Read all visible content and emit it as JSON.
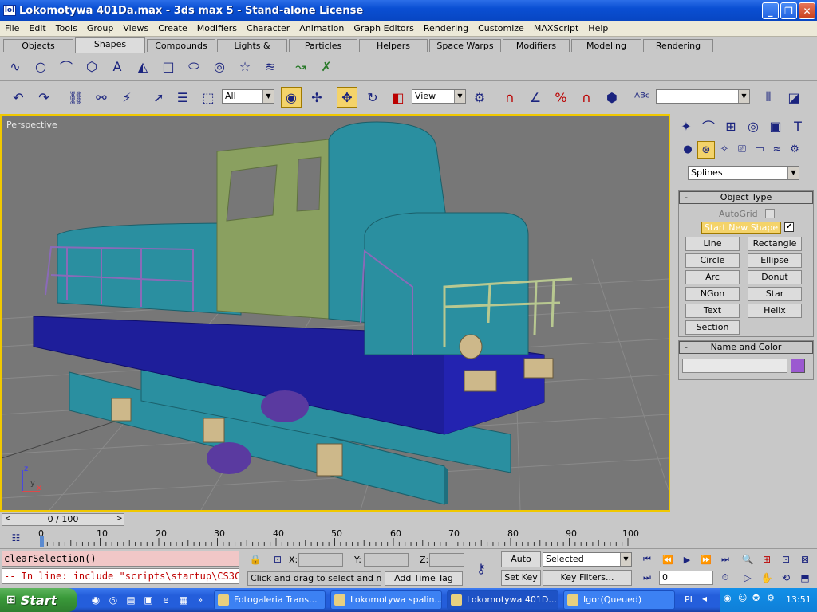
{
  "window": {
    "title": "Lokomotywa 401Da.max - 3ds max 5 - Stand-alone License",
    "icon_text": "lol"
  },
  "menu": [
    "File",
    "Edit",
    "Tools",
    "Group",
    "Views",
    "Create",
    "Modifiers",
    "Character",
    "Animation",
    "Graph Editors",
    "Rendering",
    "Customize",
    "MAXScript",
    "Help"
  ],
  "tabs": [
    "Objects",
    "Shapes",
    "Compounds",
    "Lights & Cameras",
    "Particles",
    "Helpers",
    "Space Warps",
    "Modifiers",
    "Modeling",
    "Rendering"
  ],
  "active_tab": "Shapes",
  "toolbar": {
    "selection_filter": "All",
    "reference_coord": "View",
    "named_selection": ""
  },
  "viewport": {
    "label": "Perspective",
    "axis_x": "x",
    "axis_y": "y",
    "axis_z": "z"
  },
  "command_panel": {
    "category": "Splines",
    "object_type": {
      "title": "Object Type",
      "autogrid": "AutoGrid",
      "start_new_shape": "Start New Shape",
      "buttons": [
        "Line",
        "Rectangle",
        "Circle",
        "Ellipse",
        "Arc",
        "Donut",
        "NGon",
        "Star",
        "Text",
        "Helix",
        "Section"
      ]
    },
    "name_and_color": {
      "title": "Name and Color",
      "name_value": "",
      "color": "#9b59d0"
    }
  },
  "timeline": {
    "slider": "0 / 100",
    "ticks": [
      "0",
      "10",
      "20",
      "30",
      "40",
      "50",
      "60",
      "70",
      "80",
      "90",
      "100"
    ]
  },
  "status": {
    "listener_input": "clearSelection()",
    "listener_output": "-- In line: include \"scripts\\startup\\CS3C",
    "prompt": "Click and drag to select and move",
    "add_time_tag": "Add Time Tag",
    "x_label": "X:",
    "y_label": "Y:",
    "z_label": "Z:",
    "auto_key": "Auto Key",
    "set_key": "Set Key",
    "key_mode": "Selected",
    "key_filters": "Key Filters...",
    "frame": "0"
  },
  "taskbar": {
    "start": "Start",
    "items": [
      "Fotogaleria Trans...",
      "Lokomotywa spalin...",
      "Lokomotywa 401D...",
      "Igor(Queued)"
    ],
    "language": "PL",
    "clock": "13:51"
  },
  "colors": {
    "viewport_bg": "#777777",
    "viewport_border": "#f0c800",
    "loco_teal": "#2a8fa0",
    "loco_blue": "#1e1e9a",
    "loco_cab": "#8aa060"
  }
}
